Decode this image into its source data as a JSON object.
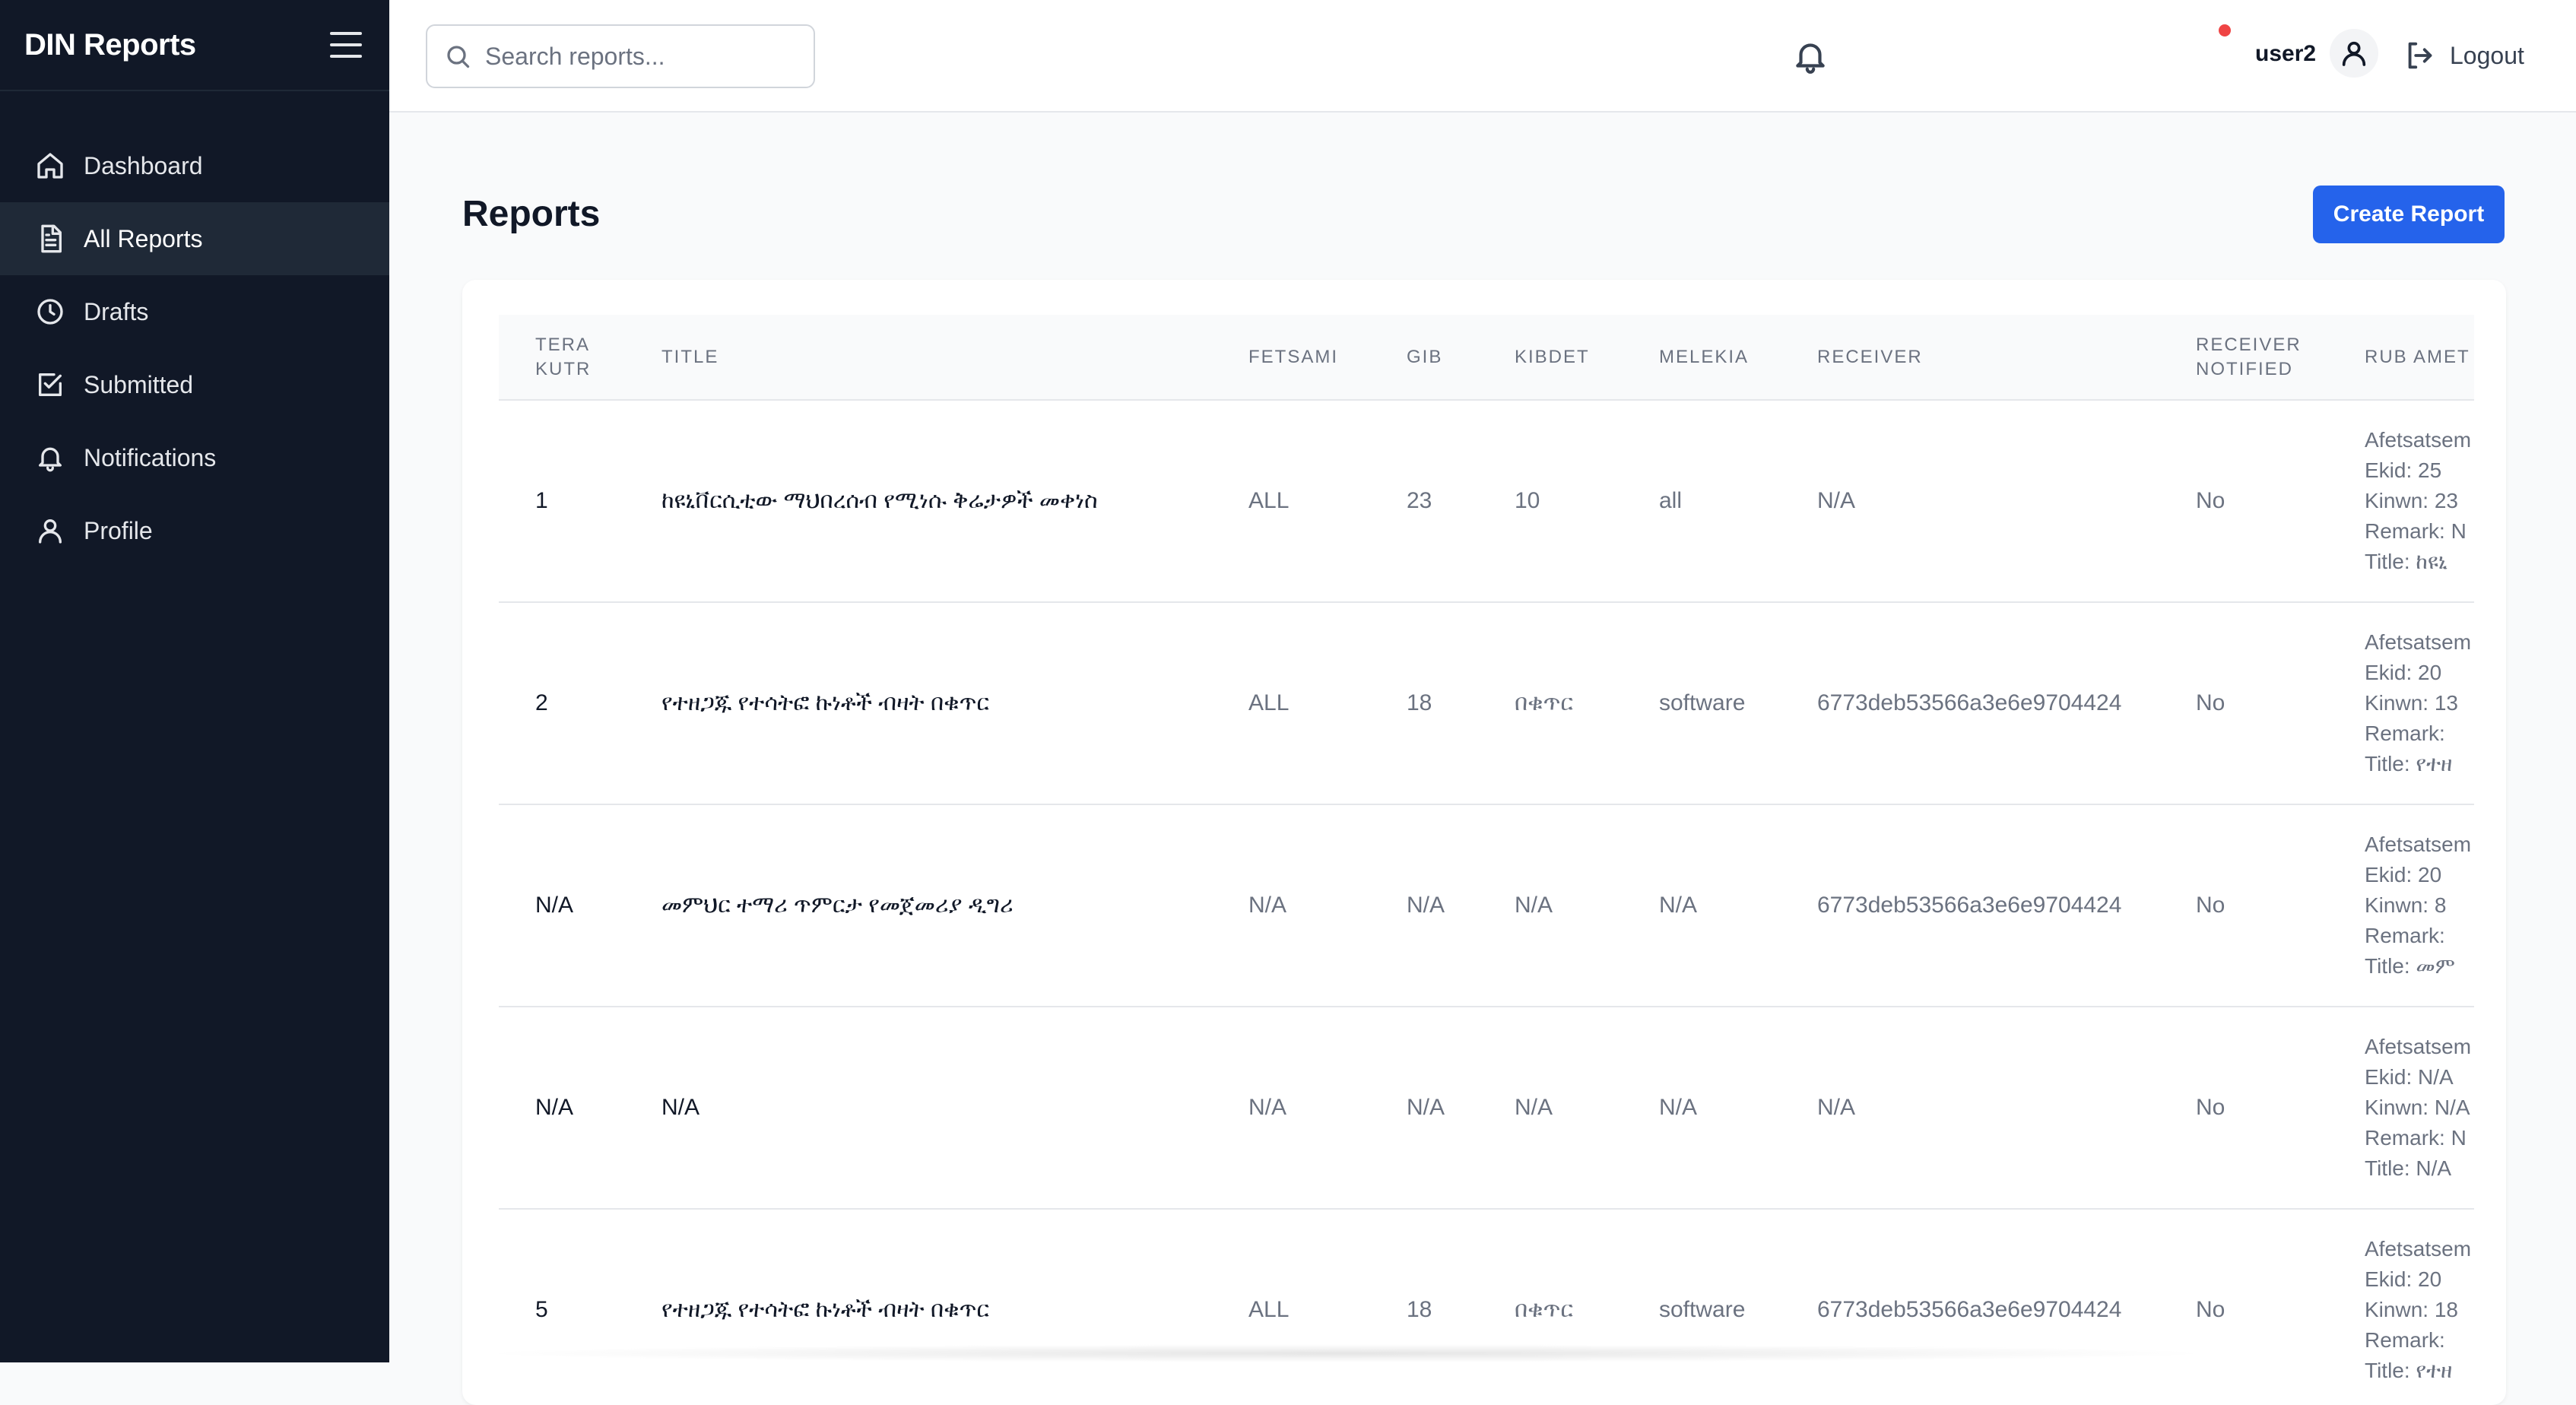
{
  "app": {
    "brand": "DIN Reports"
  },
  "sidebar": {
    "items": [
      {
        "label": "Dashboard",
        "icon": "home-icon"
      },
      {
        "label": "All Reports",
        "icon": "document-icon",
        "active": true
      },
      {
        "label": "Drafts",
        "icon": "clock-icon"
      },
      {
        "label": "Submitted",
        "icon": "check-square-icon"
      },
      {
        "label": "Notifications",
        "icon": "bell-icon"
      },
      {
        "label": "Profile",
        "icon": "user-icon"
      }
    ]
  },
  "header": {
    "search_placeholder": "Search reports...",
    "username": "user2",
    "logout_label": "Logout",
    "notification_dot_color": "#ef4444"
  },
  "main": {
    "title": "Reports",
    "create_button_label": "Create Report",
    "accent_color": "#2563eb"
  },
  "table": {
    "columns": [
      "TERA KUTR",
      "TITLE",
      "FETSAMI",
      "GIB",
      "KIBDET",
      "MELEKIA",
      "RECEIVER",
      "RECEIVER NOTIFIED",
      "RUB AMET"
    ],
    "rows": [
      {
        "tera_kutr": "1",
        "title": "ከዩኒቨርሲቲው ማህበረሰብ የሚነሱ ቅሬታዎች መቀነስ",
        "fetsami": "ALL",
        "gib": "23",
        "kibdet": "10",
        "melekia": "all",
        "receiver": "N/A",
        "receiver_notified": "No",
        "rub_amet": [
          "Afetsatsem",
          "Ekid: 25",
          "Kinwn: 23",
          "Remark: N",
          "Title: ከዩኒ"
        ]
      },
      {
        "tera_kutr": "2",
        "title": "የተዘጋጁ የተሳትፎ ኩነቶች ብዛት በቁጥር",
        "fetsami": "ALL",
        "gib": "18",
        "kibdet": "በቁጥር",
        "melekia": "software",
        "receiver": "6773deb53566a3e6e9704424",
        "receiver_notified": "No",
        "rub_amet": [
          "Afetsatsem",
          "Ekid: 20",
          "Kinwn: 13",
          "Remark:",
          "Title: የተዘ"
        ]
      },
      {
        "tera_kutr": "N/A",
        "title": "መምህር ተማሪ ጥምርታ የመጀመሪያ ዲግሪ",
        "fetsami": "N/A",
        "gib": "N/A",
        "kibdet": "N/A",
        "melekia": "N/A",
        "receiver": "6773deb53566a3e6e9704424",
        "receiver_notified": "No",
        "rub_amet": [
          "Afetsatsem",
          "Ekid: 20",
          "Kinwn: 8",
          "Remark:",
          "Title: መም"
        ]
      },
      {
        "tera_kutr": "N/A",
        "title": "N/A",
        "fetsami": "N/A",
        "gib": "N/A",
        "kibdet": "N/A",
        "melekia": "N/A",
        "receiver": "N/A",
        "receiver_notified": "No",
        "rub_amet": [
          "Afetsatsem",
          "Ekid: N/A",
          "Kinwn: N/A",
          "Remark: N",
          "Title: N/A"
        ]
      },
      {
        "tera_kutr": "5",
        "title": "የተዘጋጁ የተሳትፎ ኩነቶች ብዛት በቁጥር",
        "fetsami": "ALL",
        "gib": "18",
        "kibdet": "በቁጥር",
        "melekia": "software",
        "receiver": "6773deb53566a3e6e9704424",
        "receiver_notified": "No",
        "rub_amet": [
          "Afetsatsem",
          "Ekid: 20",
          "Kinwn: 18",
          "Remark:",
          "Title: የተዘ"
        ]
      }
    ]
  }
}
